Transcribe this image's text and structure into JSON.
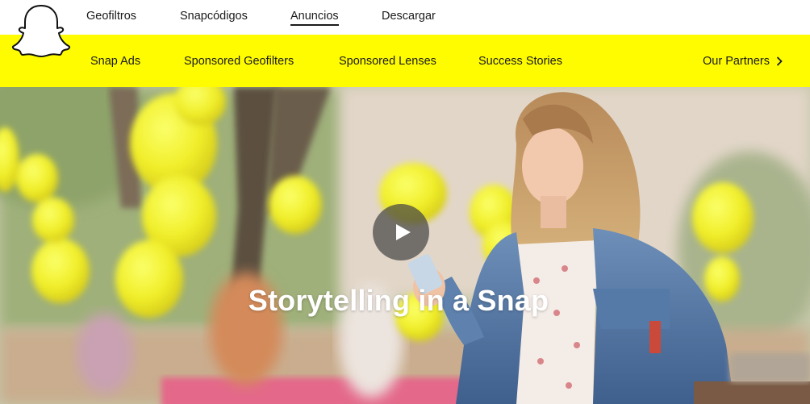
{
  "top_nav": {
    "items": [
      {
        "label": "Geofiltros"
      },
      {
        "label": "Snapcódigos"
      },
      {
        "label": "Anuncios",
        "active": true
      },
      {
        "label": "Descargar"
      }
    ]
  },
  "sub_nav": {
    "items": [
      {
        "label": "Snap Ads"
      },
      {
        "label": "Sponsored Geofilters"
      },
      {
        "label": "Sponsored Lenses"
      },
      {
        "label": "Success Stories"
      }
    ],
    "partners_label": "Our Partners",
    "partners_icon": "chevron-right-icon"
  },
  "hero": {
    "title": "Storytelling in a Snap",
    "play_icon": "play-icon"
  },
  "colors": {
    "brand_yellow": "#FFFC00",
    "text": "#1a1a1a",
    "play_button_bg": "rgba(70,70,70,0.72)"
  }
}
